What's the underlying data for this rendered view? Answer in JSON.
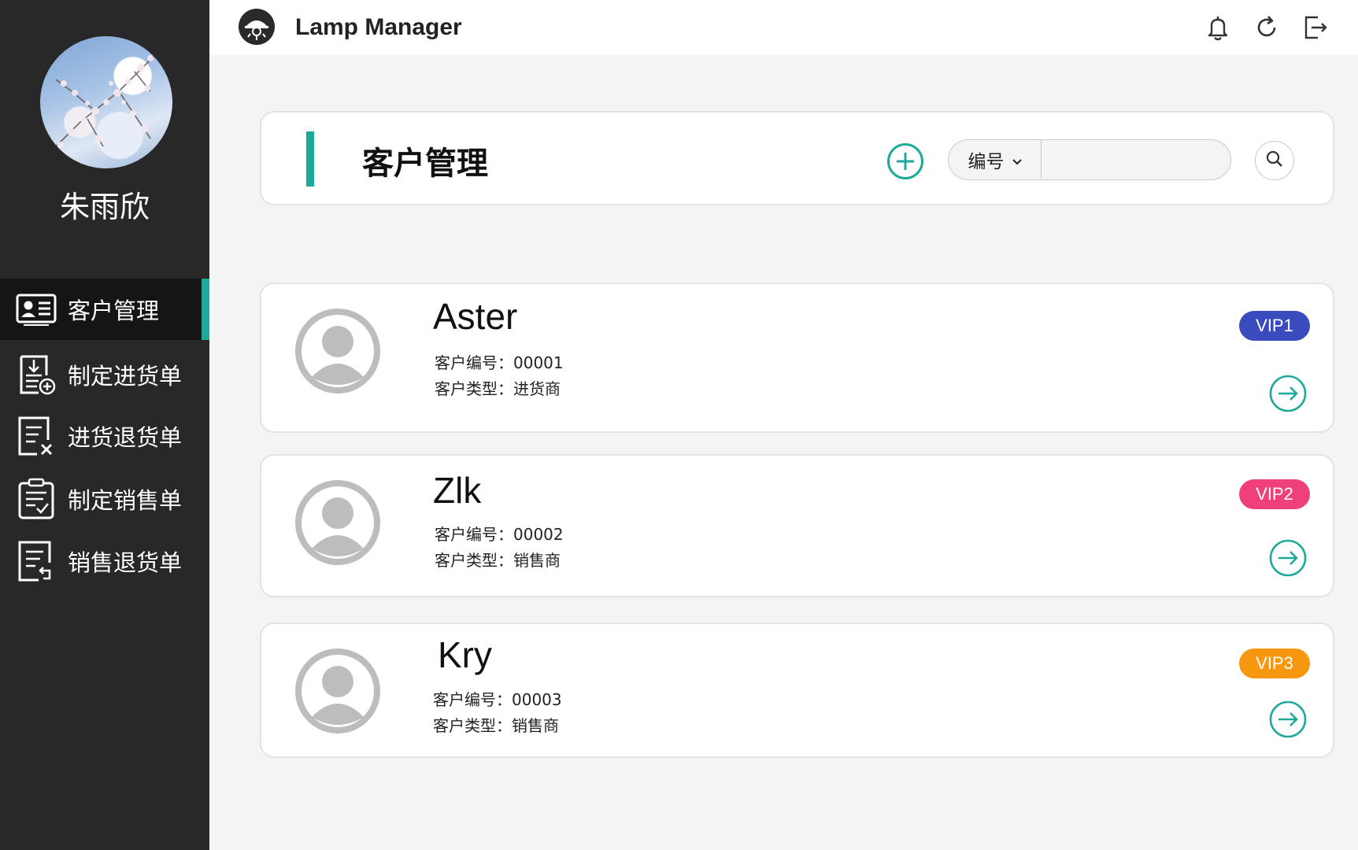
{
  "sidebar": {
    "user_name": "朱雨欣",
    "items": [
      {
        "label": "客户管理",
        "icon": "contact-card-icon",
        "active": true
      },
      {
        "label": "制定进货单",
        "icon": "download-add-doc-icon",
        "active": false
      },
      {
        "label": "进货退货单",
        "icon": "doc-cancel-icon",
        "active": false
      },
      {
        "label": "制定销售单",
        "icon": "clipboard-check-icon",
        "active": false
      },
      {
        "label": "销售退货单",
        "icon": "doc-return-icon",
        "active": false
      }
    ]
  },
  "header": {
    "app_title": "Lamp Manager",
    "icons": [
      "bell-icon",
      "refresh-icon",
      "logout-icon"
    ]
  },
  "page": {
    "title": "客户管理",
    "search": {
      "filter_value": "编号",
      "query": "",
      "placeholder": ""
    }
  },
  "customers": [
    {
      "name": "Aster",
      "id_label": "客户编号：",
      "id": "00001",
      "type_label": "客户类型：",
      "type": "进货商",
      "vip": "VIP1",
      "vip_color": "#3a4bbd"
    },
    {
      "name": "Zlk",
      "id_label": "客户编号：",
      "id": "00002",
      "type_label": "客户类型：",
      "type": "销售商",
      "vip": "VIP2",
      "vip_color": "#f0407a"
    },
    {
      "name": "Kry",
      "id_label": "客户编号：",
      "id": "00003",
      "type_label": "客户类型：",
      "type": "销售商",
      "vip": "VIP3",
      "vip_color": "#f7960f"
    }
  ],
  "colors": {
    "accent": "#1ea99b",
    "sidebar_bg": "#282828",
    "page_bg": "#f4f4f4"
  }
}
